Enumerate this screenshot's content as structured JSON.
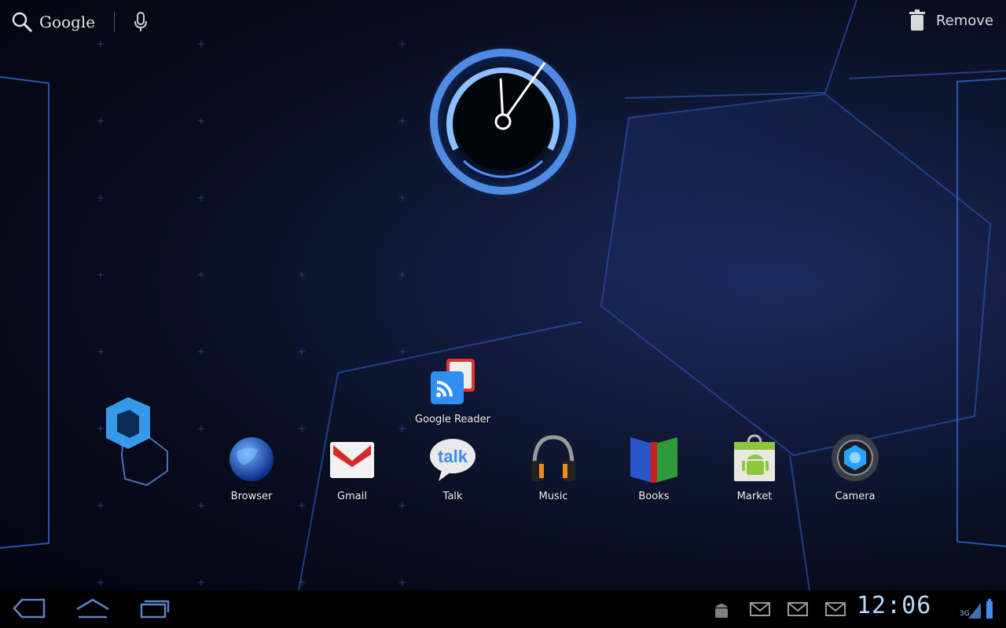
{
  "search": {
    "label": "Google"
  },
  "top_actions": {
    "remove_label": "Remove"
  },
  "widgets": {
    "clock": {
      "type": "analog-clock"
    }
  },
  "folder_apps": [
    {
      "label": "Google Reader",
      "icon": "google-reader-icon"
    }
  ],
  "apps": [
    {
      "label": "Browser",
      "icon": "browser-icon"
    },
    {
      "label": "Gmail",
      "icon": "gmail-icon"
    },
    {
      "label": "Talk",
      "icon": "talk-icon"
    },
    {
      "label": "Music",
      "icon": "music-icon"
    },
    {
      "label": "Books",
      "icon": "books-icon"
    },
    {
      "label": "Market",
      "icon": "market-icon"
    },
    {
      "label": "Camera",
      "icon": "camera-icon"
    }
  ],
  "status_bar": {
    "time": "12:06",
    "network": "3G",
    "notifications": [
      "android-debug-icon",
      "gmail-notification-icon",
      "gmail-notification-icon",
      "gmail-notification-icon"
    ]
  },
  "theme": {
    "accent": "#3d8bff",
    "glow": "#6aa8ff",
    "bar_bg": "#000000"
  }
}
